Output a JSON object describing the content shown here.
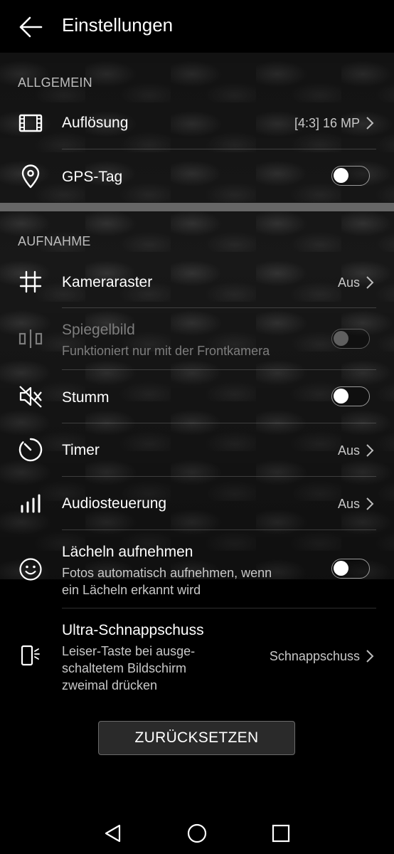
{
  "header": {
    "title": "Einstellungen"
  },
  "sections": {
    "general": "ALLGEMEIN",
    "capture": "AUFNAHME"
  },
  "rows": {
    "resolution": {
      "label": "Auflösung",
      "value": "[4:3] 16 MP",
      "icon": "film-frame-icon"
    },
    "gps": {
      "label": "GPS-Tag",
      "toggle": false,
      "icon": "location-pin-icon"
    },
    "grid": {
      "label": "Kameraraster",
      "value": "Aus",
      "icon": "grid-hash-icon"
    },
    "mirror": {
      "label": "Spiegelbild",
      "sub": "Funktioniert nur mit der Frontkamera",
      "toggle": false,
      "disabled": true,
      "icon": "mirror-icon"
    },
    "mute": {
      "label": "Stumm",
      "toggle": false,
      "icon": "speaker-mute-icon"
    },
    "timer": {
      "label": "Timer",
      "value": "Aus",
      "icon": "timer-icon"
    },
    "audio": {
      "label": "Audiosteuerung",
      "value": "Aus",
      "icon": "signal-bars-icon"
    },
    "smile": {
      "label": "Lächeln aufnehmen",
      "sub_line1": "Fotos automatisch aufnehmen, wenn",
      "sub_line2": "ein Lächeln erkannt wird",
      "toggle": false,
      "icon": "smile-icon"
    },
    "ultra": {
      "label": "Ultra-Schnappschuss",
      "sub_line1": "Leiser-Taste bei ausge-",
      "sub_line2": "schaltetem Bildschirm",
      "sub_line3": "zweimal drücken",
      "value": "Schnappschuss",
      "icon": "phone-side-button-icon"
    }
  },
  "reset_button": "ZURÜCKSETZEN",
  "navbar": {
    "back": "nav-back-icon",
    "home": "nav-home-icon",
    "recents": "nav-recents-icon"
  }
}
